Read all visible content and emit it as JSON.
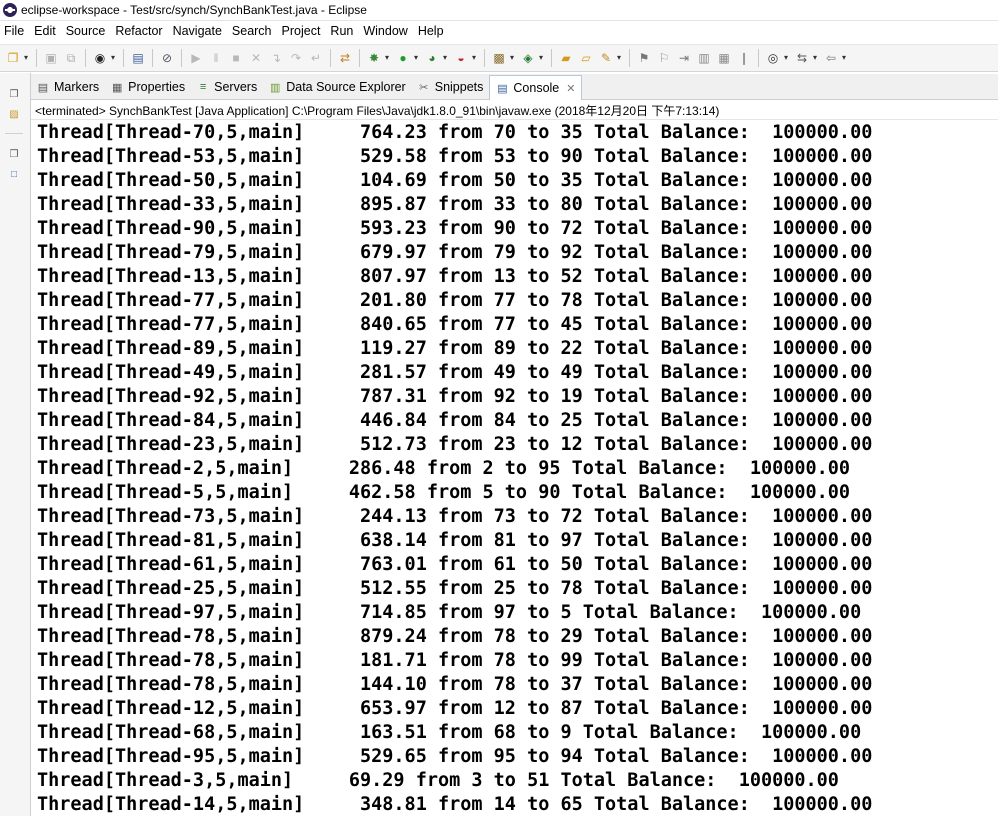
{
  "window": {
    "title": "eclipse-workspace - Test/src/synch/SynchBankTest.java - Eclipse"
  },
  "menu": [
    "File",
    "Edit",
    "Source",
    "Refactor",
    "Navigate",
    "Search",
    "Project",
    "Run",
    "Window",
    "Help"
  ],
  "toolbar_icons": [
    "new-icon",
    "save-icon",
    "save-all-icon",
    "profile-icon",
    "open-console-icon",
    "skip-breakpoints-icon",
    "resume-icon",
    "suspend-icon",
    "terminate-icon",
    "disconnect-icon",
    "step-into-icon",
    "step-over-icon",
    "step-return-icon",
    "debug-icon",
    "run-icon",
    "coverage-icon",
    "external-tools-icon",
    "new-java-project-icon",
    "new-class-icon",
    "open-type-icon",
    "search-icon",
    "next-annotation-icon",
    "previous-annotation-icon",
    "last-edit-icon",
    "back-icon",
    "forward-icon",
    "pin-icon",
    "web-browser-icon",
    "perspective-icon"
  ],
  "tabs": [
    {
      "label": "Markers",
      "icon": "markers-icon"
    },
    {
      "label": "Properties",
      "icon": "properties-icon"
    },
    {
      "label": "Servers",
      "icon": "servers-icon"
    },
    {
      "label": "Data Source Explorer",
      "icon": "data-source-explorer-icon"
    },
    {
      "label": "Snippets",
      "icon": "snippets-icon"
    },
    {
      "label": "Console",
      "icon": "console-icon",
      "active": true
    }
  ],
  "console": {
    "status": "<terminated> SynchBankTest [Java Application] C:\\Program Files\\Java\\jdk1.8.0_91\\bin\\javaw.exe (2018年12月20日 下午7:13:14)",
    "lines": [
      "Thread[Thread-70,5,main]     764.23 from 70 to 35 Total Balance:  100000.00",
      "Thread[Thread-53,5,main]     529.58 from 53 to 90 Total Balance:  100000.00",
      "Thread[Thread-50,5,main]     104.69 from 50 to 35 Total Balance:  100000.00",
      "Thread[Thread-33,5,main]     895.87 from 33 to 80 Total Balance:  100000.00",
      "Thread[Thread-90,5,main]     593.23 from 90 to 72 Total Balance:  100000.00",
      "Thread[Thread-79,5,main]     679.97 from 79 to 92 Total Balance:  100000.00",
      "Thread[Thread-13,5,main]     807.97 from 13 to 52 Total Balance:  100000.00",
      "Thread[Thread-77,5,main]     201.80 from 77 to 78 Total Balance:  100000.00",
      "Thread[Thread-77,5,main]     840.65 from 77 to 45 Total Balance:  100000.00",
      "Thread[Thread-89,5,main]     119.27 from 89 to 22 Total Balance:  100000.00",
      "Thread[Thread-49,5,main]     281.57 from 49 to 49 Total Balance:  100000.00",
      "Thread[Thread-92,5,main]     787.31 from 92 to 19 Total Balance:  100000.00",
      "Thread[Thread-84,5,main]     446.84 from 84 to 25 Total Balance:  100000.00",
      "Thread[Thread-23,5,main]     512.73 from 23 to 12 Total Balance:  100000.00",
      "Thread[Thread-2,5,main]     286.48 from 2 to 95 Total Balance:  100000.00",
      "Thread[Thread-5,5,main]     462.58 from 5 to 90 Total Balance:  100000.00",
      "Thread[Thread-73,5,main]     244.13 from 73 to 72 Total Balance:  100000.00",
      "Thread[Thread-81,5,main]     638.14 from 81 to 97 Total Balance:  100000.00",
      "Thread[Thread-61,5,main]     763.01 from 61 to 50 Total Balance:  100000.00",
      "Thread[Thread-25,5,main]     512.55 from 25 to 78 Total Balance:  100000.00",
      "Thread[Thread-97,5,main]     714.85 from 97 to 5 Total Balance:  100000.00",
      "Thread[Thread-78,5,main]     879.24 from 78 to 29 Total Balance:  100000.00",
      "Thread[Thread-78,5,main]     181.71 from 78 to 99 Total Balance:  100000.00",
      "Thread[Thread-78,5,main]     144.10 from 78 to 37 Total Balance:  100000.00",
      "Thread[Thread-12,5,main]     653.97 from 12 to 87 Total Balance:  100000.00",
      "Thread[Thread-68,5,main]     163.51 from 68 to 9 Total Balance:  100000.00",
      "Thread[Thread-95,5,main]     529.65 from 95 to 94 Total Balance:  100000.00",
      "Thread[Thread-3,5,main]     69.29 from 3 to 51 Total Balance:  100000.00",
      "Thread[Thread-14,5,main]     348.81 from 14 to 65 Total Balance:  100000.00"
    ]
  },
  "colors": {
    "toolbar_bg": "#f5f5f5",
    "active_tab_border": "#b8c7d9",
    "console_text": "#000000"
  }
}
